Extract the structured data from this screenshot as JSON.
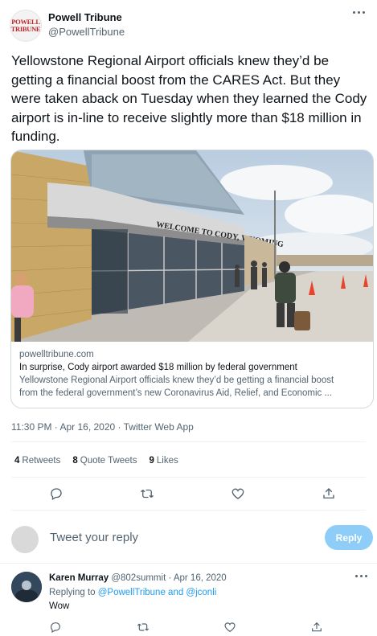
{
  "tweet": {
    "author_name": "Powell Tribune",
    "author_handle": "@PowellTribune",
    "avatar_text": [
      "POWELL",
      "TRIBUNE"
    ],
    "text": "Yellowstone Regional Airport officials knew they’d be getting a financial boost from the CARES Act. But they were taken aback on Tuesday when they learned the Cody airport is in-line to receive slightly more than $18 million in funding.",
    "card": {
      "image_sign_text": "WELCOME TO CODY, WYOMING",
      "domain": "powelltribune.com",
      "title": "In surprise, Cody airport awarded $18 million by federal government",
      "description_line1": "Yellowstone Regional Airport officials knew they’d be getting a financial boost",
      "description_line2": "from the federal government’s new Coronavirus Aid, Relief, and Economic ..."
    },
    "timestamp": "11:30 PM · Apr 16, 2020 · Twitter Web App",
    "stats": {
      "retweets_count": "4",
      "retweets_label": "Retweets",
      "quotes_count": "8",
      "quotes_label": "Quote Tweets",
      "likes_count": "9",
      "likes_label": "Likes"
    },
    "actions": [
      "reply-icon",
      "retweet-icon",
      "like-icon",
      "share-icon"
    ]
  },
  "compose": {
    "placeholder": "Tweet your reply",
    "button_label": "Reply"
  },
  "reply": {
    "author_name": "Karen Murray",
    "author_handle": "@802summit · Apr 16, 2020",
    "replying_prefix": "Replying to ",
    "replying_to": "@PowellTribune and @jconli",
    "text": "Wow"
  },
  "colors": {
    "accent": "#1d9bf0",
    "reply_button": "#8ecdf8",
    "secondary_text": "#536471"
  }
}
